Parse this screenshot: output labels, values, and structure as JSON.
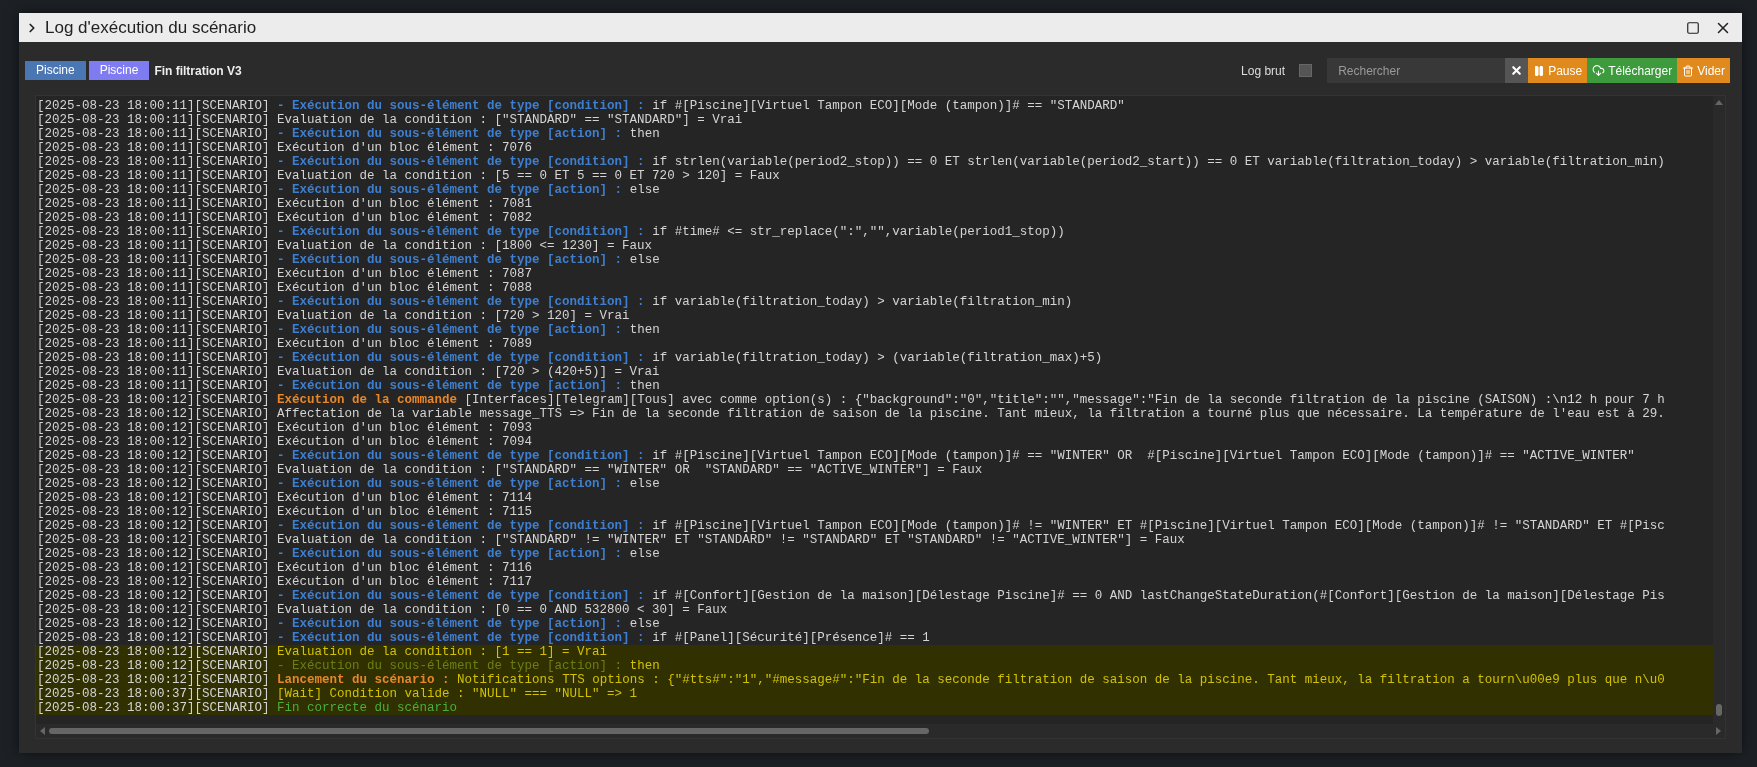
{
  "window": {
    "title": "Log d'exécution du scénario"
  },
  "toolbar": {
    "tags": [
      {
        "label": "Piscine",
        "color": "#4a77b4"
      },
      {
        "label": "Piscine",
        "color": "#7f7cf2"
      }
    ],
    "scenario_name": "Fin filtration V3",
    "raw_log": {
      "label": "Log brut",
      "checked": false
    },
    "search": {
      "placeholder": "Rechercher"
    },
    "buttons": [
      {
        "kind": "reset"
      },
      {
        "kind": "pause",
        "label": "Pause"
      },
      {
        "kind": "download",
        "label": "Télécharger"
      },
      {
        "kind": "empty",
        "label": "Vider"
      }
    ]
  },
  "log": {
    "lines": [
      {
        "time": "[2025-08-23 18:00:11][SCENARIO]",
        "highlight": false,
        "parts": [
          {
            "kind": "sub",
            "text": "- Exécution du sous-élément de type [condition] :"
          },
          {
            "kind": "plain",
            "text": "if #[Piscine][Virtuel Tampon ECO][Mode (tampon)]# == \"STANDARD\""
          }
        ]
      },
      {
        "time": "[2025-08-23 18:00:11][SCENARIO]",
        "highlight": false,
        "parts": [
          {
            "kind": "plain",
            "text": "Evaluation de la condition : [\"STANDARD\" == \"STANDARD\"] = Vrai"
          }
        ]
      },
      {
        "time": "[2025-08-23 18:00:11][SCENARIO]",
        "highlight": false,
        "parts": [
          {
            "kind": "sub",
            "text": "- Exécution du sous-élément de type [action] :"
          },
          {
            "kind": "plain",
            "text": "then"
          }
        ]
      },
      {
        "time": "[2025-08-23 18:00:11][SCENARIO]",
        "highlight": false,
        "parts": [
          {
            "kind": "plain",
            "text": "Exécution d'un bloc élément : 7076"
          }
        ]
      },
      {
        "time": "[2025-08-23 18:00:11][SCENARIO]",
        "highlight": false,
        "parts": [
          {
            "kind": "sub",
            "text": "- Exécution du sous-élément de type [condition] :"
          },
          {
            "kind": "plain",
            "text": "if strlen(variable(period2_stop)) == 0 ET strlen(variable(period2_start)) == 0 ET variable(filtration_today) > variable(filtration_min)"
          }
        ]
      },
      {
        "time": "[2025-08-23 18:00:11][SCENARIO]",
        "highlight": false,
        "parts": [
          {
            "kind": "plain",
            "text": "Evaluation de la condition : [5 == 0 ET 5 == 0 ET 720 > 120] = Faux"
          }
        ]
      },
      {
        "time": "[2025-08-23 18:00:11][SCENARIO]",
        "highlight": false,
        "parts": [
          {
            "kind": "sub",
            "text": "- Exécution du sous-élément de type [action] :"
          },
          {
            "kind": "plain",
            "text": "else"
          }
        ]
      },
      {
        "time": "[2025-08-23 18:00:11][SCENARIO]",
        "highlight": false,
        "parts": [
          {
            "kind": "plain",
            "text": "Exécution d'un bloc élément : 7081"
          }
        ]
      },
      {
        "time": "[2025-08-23 18:00:11][SCENARIO]",
        "highlight": false,
        "parts": [
          {
            "kind": "plain",
            "text": "Exécution d'un bloc élément : 7082"
          }
        ]
      },
      {
        "time": "[2025-08-23 18:00:11][SCENARIO]",
        "highlight": false,
        "parts": [
          {
            "kind": "sub",
            "text": "- Exécution du sous-élément de type [condition] :"
          },
          {
            "kind": "plain",
            "text": "if #time# <= str_replace(\":\",\"\",variable(period1_stop))"
          }
        ]
      },
      {
        "time": "[2025-08-23 18:00:11][SCENARIO]",
        "highlight": false,
        "parts": [
          {
            "kind": "plain",
            "text": "Evaluation de la condition : [1800 <= 1230] = Faux"
          }
        ]
      },
      {
        "time": "[2025-08-23 18:00:11][SCENARIO]",
        "highlight": false,
        "parts": [
          {
            "kind": "sub",
            "text": "- Exécution du sous-élément de type [action] :"
          },
          {
            "kind": "plain",
            "text": "else"
          }
        ]
      },
      {
        "time": "[2025-08-23 18:00:11][SCENARIO]",
        "highlight": false,
        "parts": [
          {
            "kind": "plain",
            "text": "Exécution d'un bloc élément : 7087"
          }
        ]
      },
      {
        "time": "[2025-08-23 18:00:11][SCENARIO]",
        "highlight": false,
        "parts": [
          {
            "kind": "plain",
            "text": "Exécution d'un bloc élément : 7088"
          }
        ]
      },
      {
        "time": "[2025-08-23 18:00:11][SCENARIO]",
        "highlight": false,
        "parts": [
          {
            "kind": "sub",
            "text": "- Exécution du sous-élément de type [condition] :"
          },
          {
            "kind": "plain",
            "text": "if variable(filtration_today) > variable(filtration_min)"
          }
        ]
      },
      {
        "time": "[2025-08-23 18:00:11][SCENARIO]",
        "highlight": false,
        "parts": [
          {
            "kind": "plain",
            "text": "Evaluation de la condition : [720 > 120] = Vrai"
          }
        ]
      },
      {
        "time": "[2025-08-23 18:00:11][SCENARIO]",
        "highlight": false,
        "parts": [
          {
            "kind": "sub",
            "text": "- Exécution du sous-élément de type [action] :"
          },
          {
            "kind": "plain",
            "text": "then"
          }
        ]
      },
      {
        "time": "[2025-08-23 18:00:11][SCENARIO]",
        "highlight": false,
        "parts": [
          {
            "kind": "plain",
            "text": "Exécution d'un bloc élément : 7089"
          }
        ]
      },
      {
        "time": "[2025-08-23 18:00:11][SCENARIO]",
        "highlight": false,
        "parts": [
          {
            "kind": "sub",
            "text": "- Exécution du sous-élément de type [condition] :"
          },
          {
            "kind": "plain",
            "text": "if variable(filtration_today) > (variable(filtration_max)+5)"
          }
        ]
      },
      {
        "time": "[2025-08-23 18:00:11][SCENARIO]",
        "highlight": false,
        "parts": [
          {
            "kind": "plain",
            "text": "Evaluation de la condition : [720 > (420+5)] = Vrai"
          }
        ]
      },
      {
        "time": "[2025-08-23 18:00:11][SCENARIO]",
        "highlight": false,
        "parts": [
          {
            "kind": "sub",
            "text": "- Exécution du sous-élément de type [action] :"
          },
          {
            "kind": "plain",
            "text": "then"
          }
        ]
      },
      {
        "time": "[2025-08-23 18:00:12][SCENARIO]",
        "highlight": false,
        "parts": [
          {
            "kind": "command",
            "text": "Exécution de la commande"
          },
          {
            "kind": "plain",
            "text": "[Interfaces][Telegram][Tous] avec comme option(s) : {\"background\":\"0\",\"title\":\"\",\"message\":\"Fin de la seconde filtration de la piscine (SAISON) :\\n12 h pour 7 h"
          }
        ]
      },
      {
        "time": "[2025-08-23 18:00:12][SCENARIO]",
        "highlight": false,
        "parts": [
          {
            "kind": "plain",
            "text": "Affectation de la variable message_TTS => Fin de la seconde filtration de saison de la piscine. Tant mieux, la filtration a tourné plus que nécessaire. La température de l'eau est à 29."
          }
        ]
      },
      {
        "time": "[2025-08-23 18:00:12][SCENARIO]",
        "highlight": false,
        "parts": [
          {
            "kind": "plain",
            "text": "Exécution d'un bloc élément : 7093"
          }
        ]
      },
      {
        "time": "[2025-08-23 18:00:12][SCENARIO]",
        "highlight": false,
        "parts": [
          {
            "kind": "plain",
            "text": "Exécution d'un bloc élément : 7094"
          }
        ]
      },
      {
        "time": "[2025-08-23 18:00:12][SCENARIO]",
        "highlight": false,
        "parts": [
          {
            "kind": "sub",
            "text": "- Exécution du sous-élément de type [condition] :"
          },
          {
            "kind": "plain",
            "text": "if #[Piscine][Virtuel Tampon ECO][Mode (tampon)]# == \"WINTER\" OR  #[Piscine][Virtuel Tampon ECO][Mode (tampon)]# == \"ACTIVE_WINTER\""
          }
        ]
      },
      {
        "time": "[2025-08-23 18:00:12][SCENARIO]",
        "highlight": false,
        "parts": [
          {
            "kind": "plain",
            "text": "Evaluation de la condition : [\"STANDARD\" == \"WINTER\" OR  \"STANDARD\" == \"ACTIVE_WINTER\"] = Faux"
          }
        ]
      },
      {
        "time": "[2025-08-23 18:00:12][SCENARIO]",
        "highlight": false,
        "parts": [
          {
            "kind": "sub",
            "text": "- Exécution du sous-élément de type [action] :"
          },
          {
            "kind": "plain",
            "text": "else"
          }
        ]
      },
      {
        "time": "[2025-08-23 18:00:12][SCENARIO]",
        "highlight": false,
        "parts": [
          {
            "kind": "plain",
            "text": "Exécution d'un bloc élément : 7114"
          }
        ]
      },
      {
        "time": "[2025-08-23 18:00:12][SCENARIO]",
        "highlight": false,
        "parts": [
          {
            "kind": "plain",
            "text": "Exécution d'un bloc élément : 7115"
          }
        ]
      },
      {
        "time": "[2025-08-23 18:00:12][SCENARIO]",
        "highlight": false,
        "parts": [
          {
            "kind": "sub",
            "text": "- Exécution du sous-élément de type [condition] :"
          },
          {
            "kind": "plain",
            "text": "if #[Piscine][Virtuel Tampon ECO][Mode (tampon)]# != \"WINTER\" ET #[Piscine][Virtuel Tampon ECO][Mode (tampon)]# != \"STANDARD\" ET #[Pisc"
          }
        ]
      },
      {
        "time": "[2025-08-23 18:00:12][SCENARIO]",
        "highlight": false,
        "parts": [
          {
            "kind": "plain",
            "text": "Evaluation de la condition : [\"STANDARD\" != \"WINTER\" ET \"STANDARD\" != \"STANDARD\" ET \"STANDARD\" != \"ACTIVE_WINTER\"] = Faux"
          }
        ]
      },
      {
        "time": "[2025-08-23 18:00:12][SCENARIO]",
        "highlight": false,
        "parts": [
          {
            "kind": "sub",
            "text": "- Exécution du sous-élément de type [action] :"
          },
          {
            "kind": "plain",
            "text": "else"
          }
        ]
      },
      {
        "time": "[2025-08-23 18:00:12][SCENARIO]",
        "highlight": false,
        "parts": [
          {
            "kind": "plain",
            "text": "Exécution d'un bloc élément : 7116"
          }
        ]
      },
      {
        "time": "[2025-08-23 18:00:12][SCENARIO]",
        "highlight": false,
        "parts": [
          {
            "kind": "plain",
            "text": "Exécution d'un bloc élément : 7117"
          }
        ]
      },
      {
        "time": "[2025-08-23 18:00:12][SCENARIO]",
        "highlight": false,
        "parts": [
          {
            "kind": "sub",
            "text": "- Exécution du sous-élément de type [condition] :"
          },
          {
            "kind": "plain",
            "text": "if #[Confort][Gestion de la maison][Délestage Piscine]# == 0 AND lastChangeStateDuration(#[Confort][Gestion de la maison][Délestage Pis"
          }
        ]
      },
      {
        "time": "[2025-08-23 18:00:12][SCENARIO]",
        "highlight": false,
        "parts": [
          {
            "kind": "plain",
            "text": "Evaluation de la condition : [0 == 0 AND 532800 < 30] = Faux"
          }
        ]
      },
      {
        "time": "[2025-08-23 18:00:12][SCENARIO]",
        "highlight": false,
        "parts": [
          {
            "kind": "sub",
            "text": "- Exécution du sous-élément de type [action] :"
          },
          {
            "kind": "plain",
            "text": "else"
          }
        ]
      },
      {
        "time": "[2025-08-23 18:00:12][SCENARIO]",
        "highlight": false,
        "parts": [
          {
            "kind": "sub",
            "text": "- Exécution du sous-élément de type [condition] :"
          },
          {
            "kind": "plain",
            "text": "if #[Panel][Sécurité][Présence]# == 1"
          }
        ]
      },
      {
        "time": "[2025-08-23 18:00:12][SCENARIO]",
        "highlight": true,
        "parts": [
          {
            "kind": "warn",
            "text": "Evaluation de la condition : [1 == 1] = Vrai"
          }
        ]
      },
      {
        "time": "[2025-08-23 18:00:12][SCENARIO]",
        "highlight": true,
        "parts": [
          {
            "kind": "dim",
            "text": "- Exécution du sous-élément de type [action] :"
          },
          {
            "kind": "warn",
            "text": "then"
          }
        ]
      },
      {
        "time": "[2025-08-23 18:00:12][SCENARIO]",
        "highlight": true,
        "parts": [
          {
            "kind": "command",
            "text": "Lancement du scénario :"
          },
          {
            "kind": "warn",
            "text": "Notifications TTS options : {\"#tts#\":\"1\",\"#message#\":\"Fin de la seconde filtration de saison de la piscine. Tant mieux, la filtration a tourn\\u00e9 plus que n\\u0"
          }
        ]
      },
      {
        "time": "[2025-08-23 18:00:37][SCENARIO]",
        "highlight": true,
        "parts": [
          {
            "kind": "warn",
            "text": "[Wait] Condition valide : \"NULL\" === \"NULL\" => 1"
          }
        ]
      },
      {
        "time": "[2025-08-23 18:00:37][SCENARIO]",
        "highlight": true,
        "parts": [
          {
            "kind": "ok",
            "text": "Fin correcte du scénario"
          }
        ]
      }
    ]
  }
}
